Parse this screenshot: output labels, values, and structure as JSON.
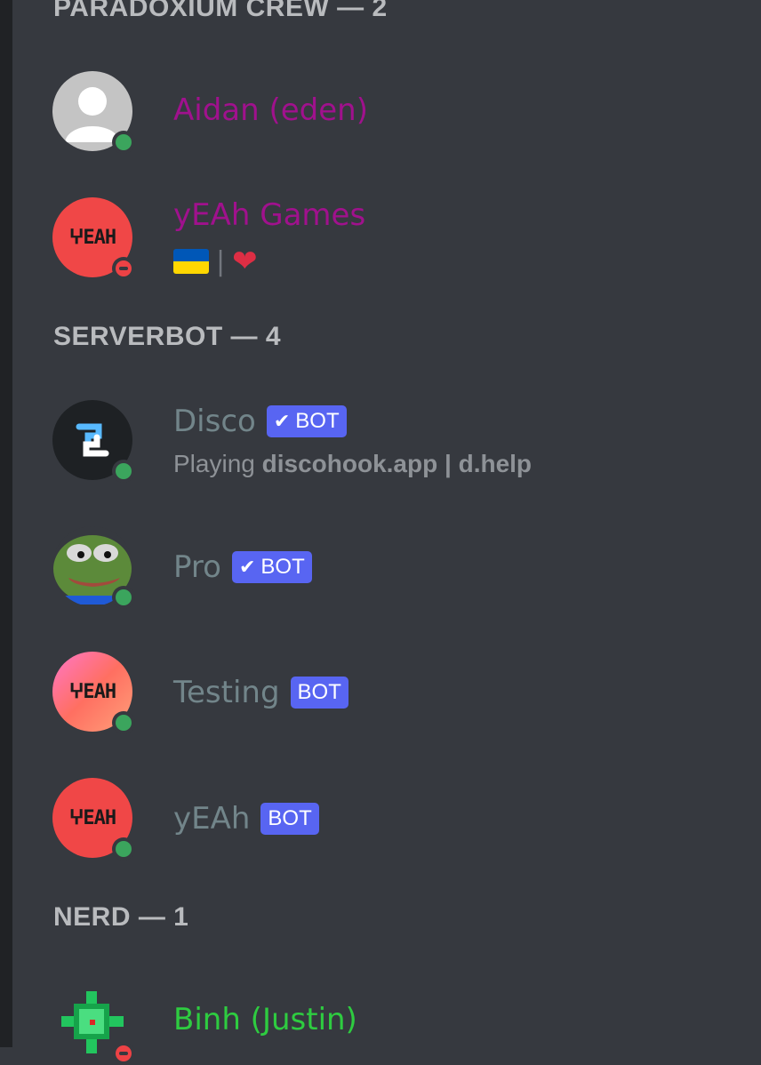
{
  "colors": {
    "background": "#36393f",
    "header": "#b9bbbe",
    "crew_role": "#a0118d",
    "bot_name": "#72858a",
    "nerd_role": "#2ecc40",
    "bot_tag": "#5865f2",
    "online": "#3ba55d",
    "dnd": "#ed4245"
  },
  "groups": [
    {
      "header": "PARADOXIUM CREW — 2",
      "members": [
        {
          "name": "Aidan (eden)",
          "status": "online",
          "avatar": "default-avatar-icon"
        },
        {
          "name": "yEAh Games",
          "status": "dnd",
          "avatar": "yeah-logo",
          "status_text_sep": "|"
        }
      ]
    },
    {
      "header": "SERVERBOT — 4",
      "members": [
        {
          "name": "Disco",
          "bot_tag": "BOT",
          "verified": true,
          "status": "online",
          "avatar": "discohook-logo",
          "activity_prefix": "Playing",
          "activity_name": "discohook.app | d.help"
        },
        {
          "name": "Pro",
          "bot_tag": "BOT",
          "verified": true,
          "status": "online",
          "avatar": "pepe-frog"
        },
        {
          "name": "Testing",
          "bot_tag": "BOT",
          "verified": false,
          "status": "online",
          "avatar": "yeah-logo-pink"
        },
        {
          "name": "yEAh",
          "bot_tag": "BOT",
          "verified": false,
          "status": "online",
          "avatar": "yeah-logo"
        }
      ]
    },
    {
      "header": "NERD — 1",
      "members": [
        {
          "name": "Binh (Justin)",
          "status": "dnd",
          "avatar": "green-crosshair-pixel"
        }
      ]
    }
  ],
  "logo_text": "ⵖEAH"
}
